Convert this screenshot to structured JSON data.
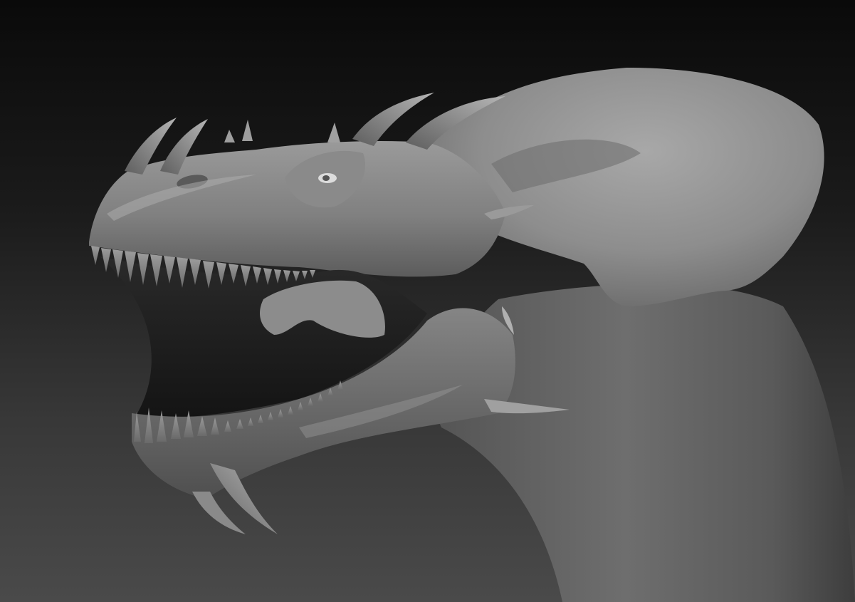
{
  "scene": {
    "subject": "dragon-head-sculpt",
    "colors": {
      "background_top": "#0a0a0a",
      "background_bottom": "#4a4a4a",
      "clay_light": "#a3a3a3",
      "clay_mid": "#7f7f7f",
      "clay_dark": "#3b3b3b"
    }
  }
}
